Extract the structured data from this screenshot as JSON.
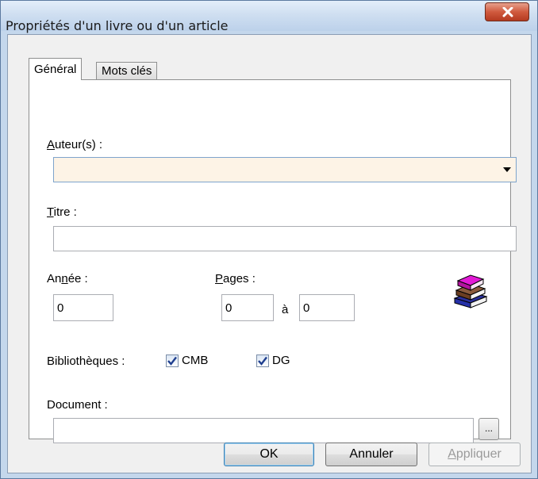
{
  "window": {
    "title": "Propriétés d'un livre ou d'un article"
  },
  "tabs": [
    {
      "label": "Général",
      "active": true
    },
    {
      "label": "Mots clés",
      "active": false
    }
  ],
  "form": {
    "author_label_access": "A",
    "author_label_rest": "uteur(s) :",
    "author_value": "",
    "title_label_access": "T",
    "title_label_rest": "itre :",
    "title_value": "",
    "year_label_pre": "An",
    "year_label_access": "n",
    "year_label_post": "ée :",
    "year_value": "0",
    "pages_label_access": "P",
    "pages_label_rest": "ages :",
    "pages_from": "0",
    "pages_to_label": "à",
    "pages_to": "0",
    "libraries_label": "Bibliothèques :",
    "libraries": [
      {
        "label": "CMB",
        "checked": true
      },
      {
        "label": "DG",
        "checked": true
      }
    ],
    "document_label": "Document :",
    "document_value": "",
    "browse_label": "..."
  },
  "buttons": {
    "ok": "OK",
    "cancel": "Annuler",
    "apply_access": "A",
    "apply_rest": "ppliquer"
  },
  "icons": {
    "books": "books-icon",
    "close": "close-icon",
    "dropdown": "chevron-down-icon"
  }
}
